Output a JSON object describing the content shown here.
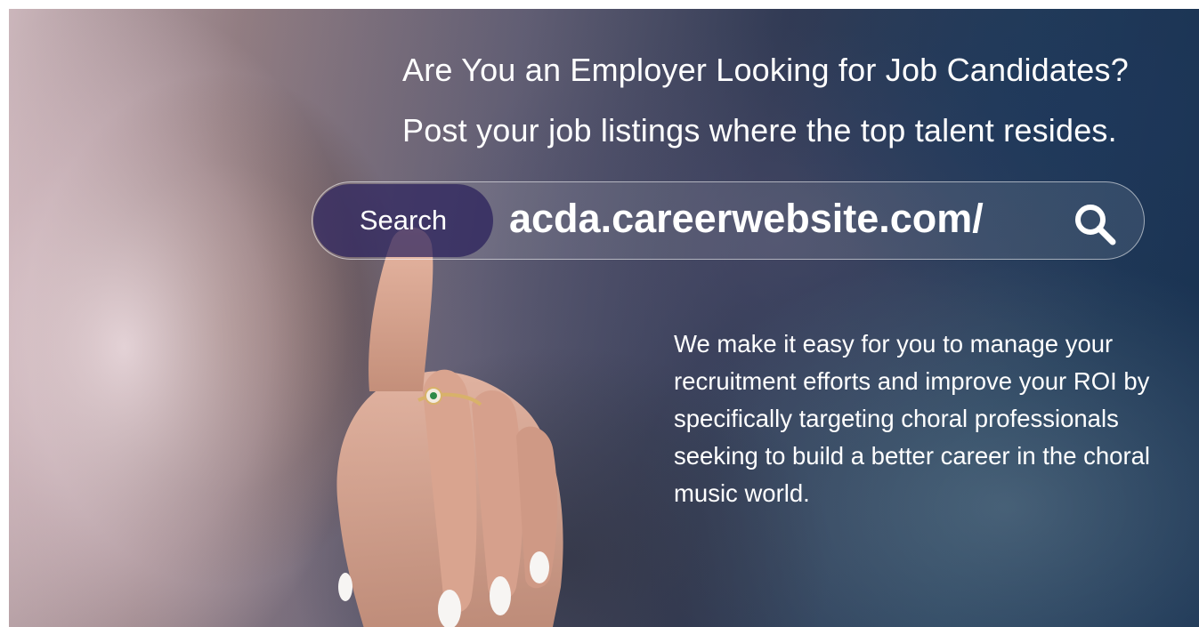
{
  "banner": {
    "headline": "Are You an Employer Looking for Job Candidates?",
    "subheadline": "Post your job listings where the top talent resides."
  },
  "search": {
    "button_label": "Search",
    "url": "acda.careerwebsite.com/",
    "icon": "search-icon"
  },
  "description": {
    "text": "We make it easy for you to manage your recruitment efforts and improve your ROI by specifically targeting choral professionals seeking to build a better career in the choral music world."
  },
  "colors": {
    "search_button_bg": "#2a1e5a",
    "text": "#ffffff",
    "background_dark": "#1f3e62"
  }
}
